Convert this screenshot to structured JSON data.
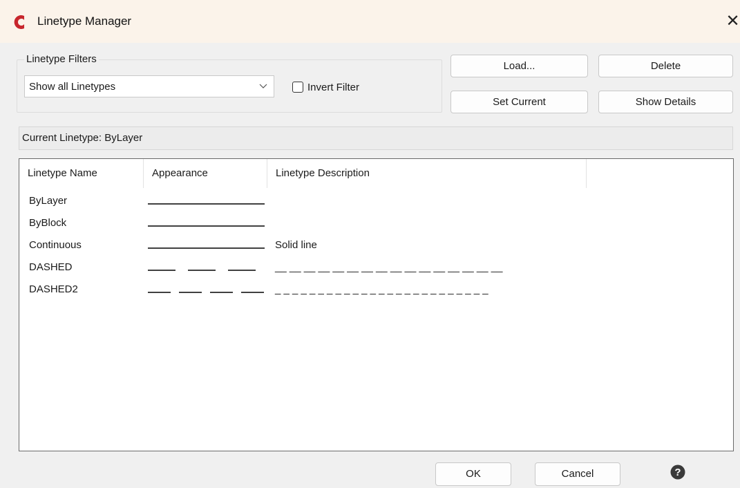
{
  "window": {
    "title": "Linetype Manager",
    "close_glyph": "✕",
    "app_icon": "app-logo-icon"
  },
  "filters": {
    "legend": "Linetype Filters",
    "selected": "Show all Linetypes",
    "invert_label": "Invert Filter",
    "invert_checked": false
  },
  "buttons": {
    "load": "Load...",
    "delete": "Delete",
    "set_current": "Set Current",
    "show_details": "Show Details",
    "ok": "OK",
    "cancel": "Cancel"
  },
  "current_linetype": "Current Linetype: ByLayer",
  "table": {
    "headers": [
      "Linetype Name",
      "Appearance",
      "Linetype Description"
    ],
    "rows": [
      {
        "name": "ByLayer",
        "appearance": "solid",
        "description": ""
      },
      {
        "name": "ByBlock",
        "appearance": "solid",
        "description": ""
      },
      {
        "name": "Continuous",
        "appearance": "solid",
        "description": "Solid line"
      },
      {
        "name": "DASHED",
        "appearance": "dashed",
        "description": "__ __ __ __ __ __ __ __ __ __ __ __ __ __ __ __"
      },
      {
        "name": "DASHED2",
        "appearance": "dashed2",
        "description": "_ _ _ _ _ _ _ _ _ _ _ _ _ _ _ _ _ _ _ _ _ _ _ _ _"
      }
    ]
  },
  "colors": {
    "brand_red": "#c7262d",
    "titlebar_bg": "#fbf3ea",
    "list_border": "#6a6a6a"
  },
  "help_icon": "question-circle-icon"
}
